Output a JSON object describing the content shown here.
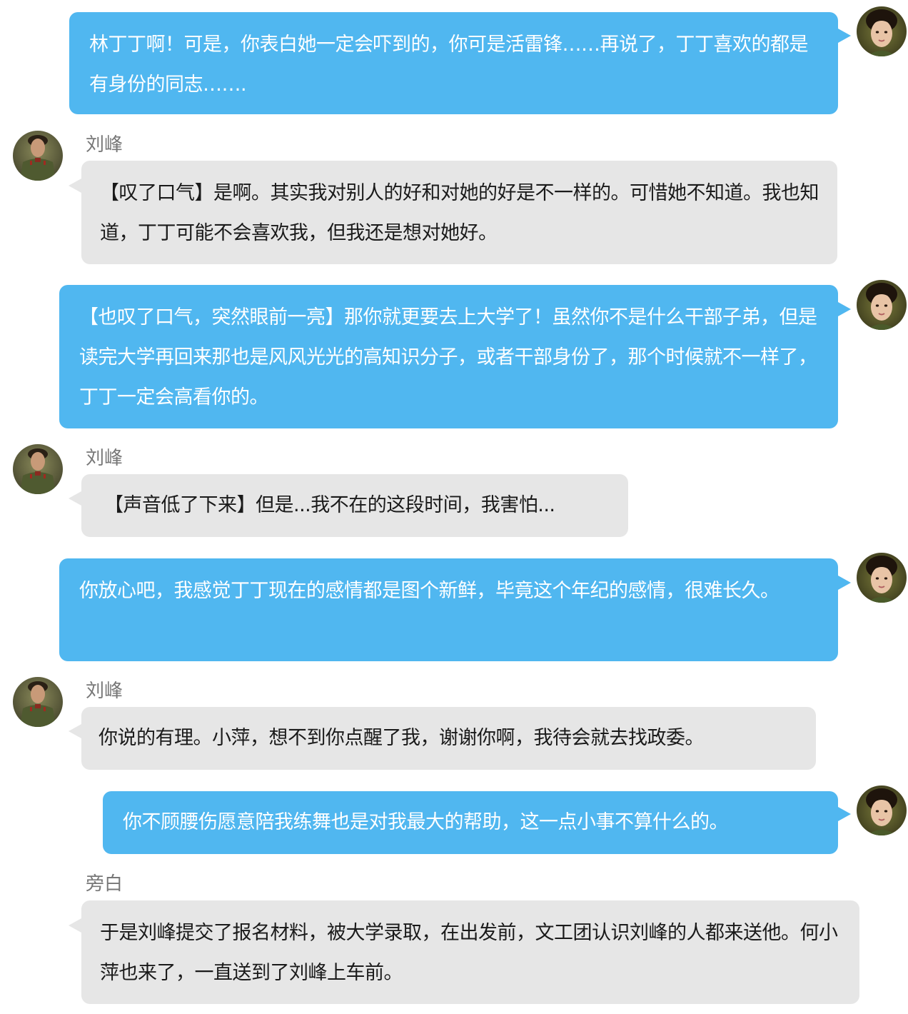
{
  "colors": {
    "right_bubble": "#50b7f0",
    "left_bubble": "#e6e6e6",
    "speaker_name": "#777777"
  },
  "messages": [
    {
      "side": "right",
      "avatar_icon": "female-avatar-icon",
      "text": "林丁丁啊！可是，你表白她一定会吓到的，你可是活雷锋……再说了，丁丁喜欢的都是有身份的同志……."
    },
    {
      "side": "left",
      "speaker": "刘峰",
      "avatar_icon": "male-soldier-avatar-icon",
      "text": "【叹了口气】是啊。其实我对别人的好和对她的好是不一样的。可惜她不知道。我也知道，丁丁可能不会喜欢我，但我还是想对她好。"
    },
    {
      "side": "right",
      "avatar_icon": "female-avatar-icon",
      "text": "【也叹了口气，突然眼前一亮】那你就更要去上大学了！虽然你不是什么干部子弟，但是读完大学再回来那也是风风光光的高知识分子，或者干部身份了，那个时候就不一样了，丁丁一定会高看你的。"
    },
    {
      "side": "left",
      "speaker": "刘峰",
      "avatar_icon": "male-soldier-avatar-icon",
      "text": "【声音低了下来】但是...我不在的这段时间，我害怕..."
    },
    {
      "side": "right",
      "avatar_icon": "female-avatar-icon",
      "text": "你放心吧，我感觉丁丁现在的感情都是图个新鲜，毕竟这个年纪的感情，很难长久。"
    },
    {
      "side": "left",
      "speaker": "刘峰",
      "avatar_icon": "male-soldier-avatar-icon",
      "text": "你说的有理。小萍，想不到你点醒了我，谢谢你啊，我待会就去找政委。"
    },
    {
      "side": "right",
      "avatar_icon": "female-avatar-icon",
      "text": "你不顾腰伤愿意陪我练舞也是对我最大的帮助，这一点小事不算什么的。"
    },
    {
      "side": "left",
      "speaker": "旁白",
      "text": "于是刘峰提交了报名材料，被大学录取，在出发前，文工团认识刘峰的人都来送他。何小萍也来了，一直送到了刘峰上车前。"
    }
  ]
}
